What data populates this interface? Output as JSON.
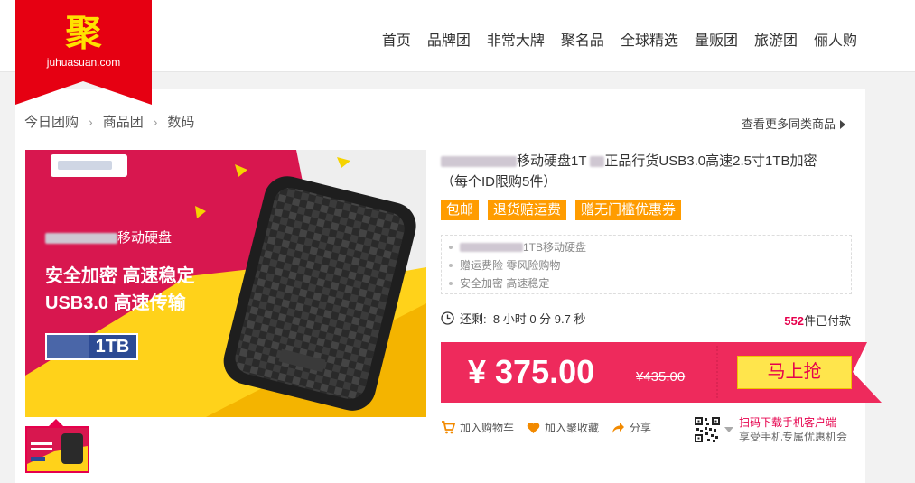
{
  "header": {
    "logo_char": "聚",
    "logo_domain": "juhuasuan.com",
    "nav": [
      "首页",
      "品牌团",
      "非常大牌",
      "聚名品",
      "全球精选",
      "量贩团",
      "旅游团",
      "俪人购"
    ]
  },
  "breadcrumb": {
    "items": [
      "今日团购",
      "商品团",
      "数码"
    ],
    "more_link": "查看更多同类商品"
  },
  "hero": {
    "subtitle": "移动硬盘",
    "line1": "安全加密  高速稳定",
    "line2": "USB3.0 高速传输",
    "badge": "1TB"
  },
  "product": {
    "title_main": "移动硬盘1T",
    "title_rest": "正品行货USB3.0高速2.5寸1TB加密",
    "title_note": "（每个ID限购5件）",
    "tags": [
      "包邮",
      "退货赔运费",
      "赠无门槛优惠券"
    ],
    "features": [
      "1TB移动硬盘",
      "赠运费险 零风险购物",
      "安全加密 高速稳定"
    ]
  },
  "timer": {
    "label": "还剩:",
    "value": "8 小时 0 分 9.7 秒"
  },
  "sales": {
    "count": "552",
    "suffix": "件已付款"
  },
  "price": {
    "current": "¥ 375.00",
    "original": "¥435.00",
    "buy_label": "马上抢"
  },
  "actions": {
    "cart": "加入购物车",
    "favorite": "加入聚收藏",
    "share": "分享"
  },
  "app_promo": {
    "line1": "扫码下载手机客户端",
    "line2": "享受手机专属优惠机会"
  },
  "colors": {
    "brand_red": "#e6004c",
    "orange": "#ff9c00",
    "gold": "#ffe100",
    "price_pink": "#ee2a5c"
  }
}
